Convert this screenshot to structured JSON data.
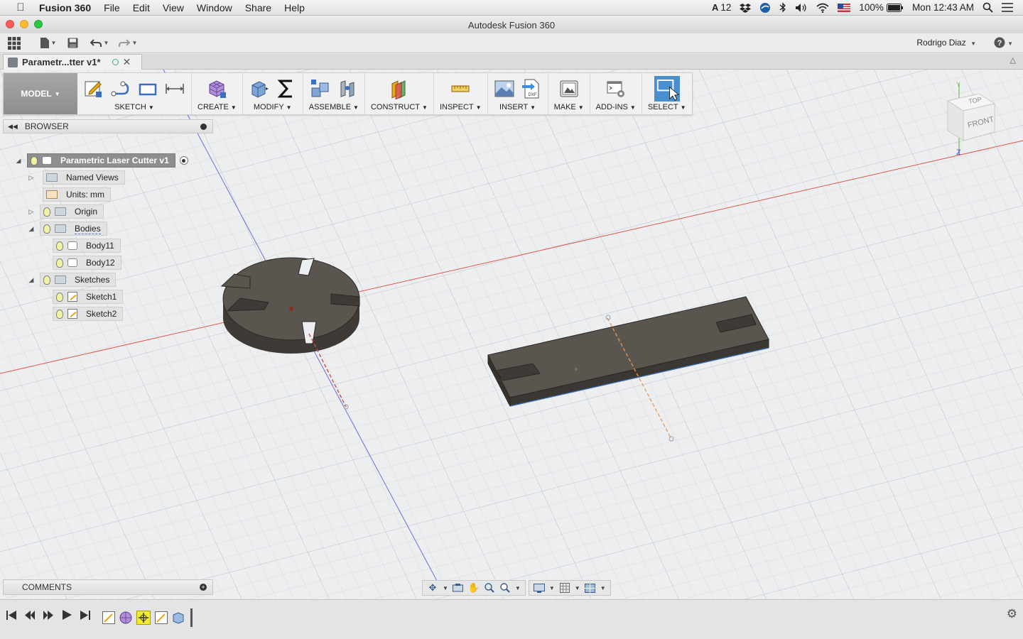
{
  "menubar": {
    "app_name": "Fusion 360",
    "items": [
      "File",
      "Edit",
      "View",
      "Window",
      "Share",
      "Help"
    ],
    "status_count": "12",
    "battery": "100%",
    "clock": "Mon 12:43 AM"
  },
  "window": {
    "title": "Autodesk Fusion 360"
  },
  "user": {
    "name": "Rodrigo Diaz"
  },
  "document": {
    "tab_title": "Parametr...tter v1*"
  },
  "toolbar": {
    "workspace": "MODEL",
    "groups": [
      "SKETCH",
      "CREATE",
      "MODIFY",
      "ASSEMBLE",
      "CONSTRUCT",
      "INSPECT",
      "INSERT",
      "MAKE",
      "ADD-INS",
      "SELECT"
    ],
    "insert_badge": "DXF"
  },
  "browser": {
    "title": "BROWSER",
    "root": "Parametric Laser Cutter v1",
    "named_views": "Named Views",
    "units": "Units: mm",
    "origin": "Origin",
    "bodies": "Bodies",
    "body_items": [
      "Body11",
      "Body12"
    ],
    "sketches": "Sketches",
    "sketch_items": [
      "Sketch1",
      "Sketch2"
    ]
  },
  "viewcube": {
    "top": "TOP",
    "front": "FRONT",
    "axis_y": "Y",
    "axis_z": "Z"
  },
  "comments": {
    "title": "COMMENTS"
  },
  "colors": {
    "accent": "#3c6fbf",
    "body": "#57524d",
    "axis_red": "#e0574f",
    "axis_blue": "#6b6fd8",
    "timeline_selected": "#f2ec31"
  }
}
